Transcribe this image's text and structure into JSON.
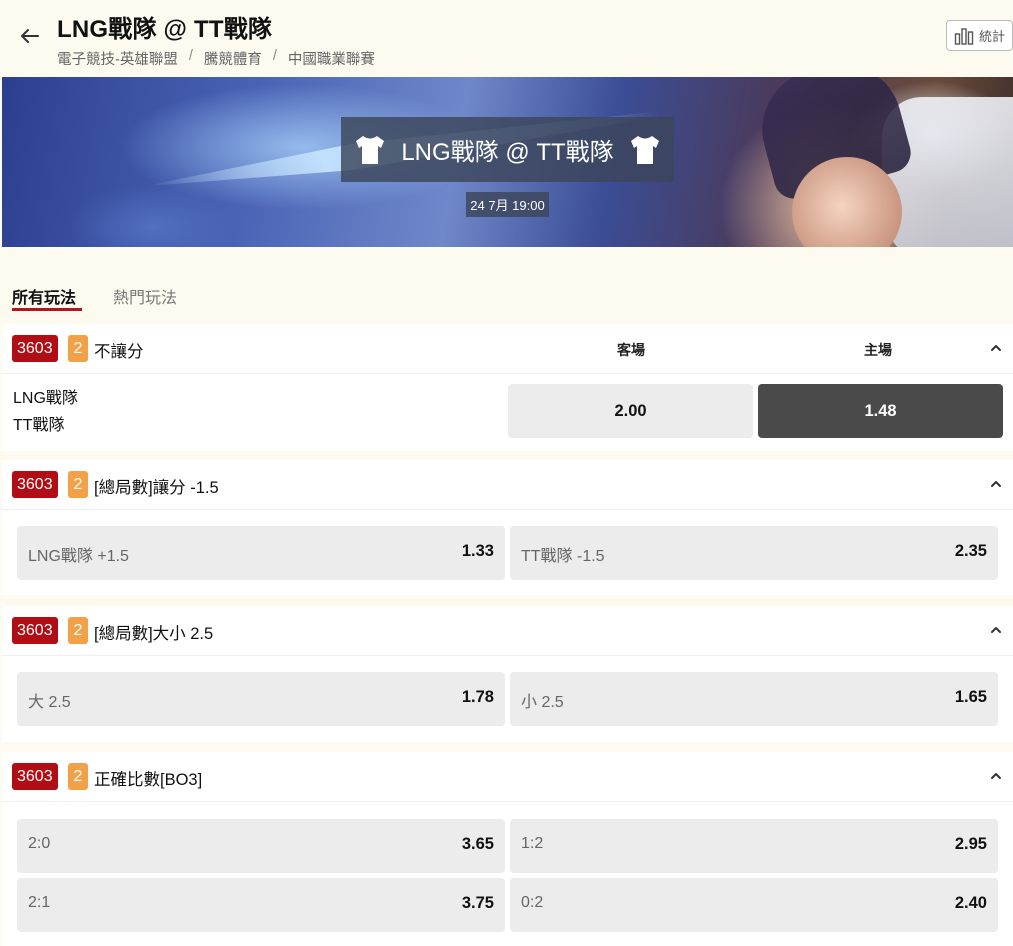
{
  "header": {
    "title": "LNG戰隊 @ TT戰隊",
    "breadcrumbs": [
      "電子競技-英雄聯盟",
      "騰競體育",
      "中國職業聯賽"
    ],
    "stats_label": "統計"
  },
  "banner": {
    "matchup": "LNG戰隊 @ TT戰隊",
    "datetime": "24 7月 19:00"
  },
  "tabs": [
    {
      "label": "所有玩法",
      "active": true
    },
    {
      "label": "熱門玩法",
      "active": false
    }
  ],
  "markets": [
    {
      "code": "3603",
      "count": "2",
      "title": "不讓分",
      "columns": [
        "客場",
        "主場"
      ],
      "teams": [
        "LNG戰隊",
        "TT戰隊"
      ],
      "odds": [
        "2.00",
        "1.48"
      ],
      "selected_index": 1
    },
    {
      "code": "3603",
      "count": "2",
      "title": "[總局數]讓分 -1.5",
      "options": [
        {
          "label": "LNG戰隊 +1.5",
          "odds": "1.33"
        },
        {
          "label": "TT戰隊 -1.5",
          "odds": "2.35"
        }
      ]
    },
    {
      "code": "3603",
      "count": "2",
      "title": "[總局數]大小 2.5",
      "options": [
        {
          "label": "大 2.5",
          "odds": "1.78"
        },
        {
          "label": "小 2.5",
          "odds": "1.65"
        }
      ]
    },
    {
      "code": "3603",
      "count": "2",
      "title": "正確比數[BO3]",
      "options": [
        {
          "label": "2:0",
          "odds": "3.65"
        },
        {
          "label": "1:2",
          "odds": "2.95"
        },
        {
          "label": "2:1",
          "odds": "3.75"
        },
        {
          "label": "0:2",
          "odds": "2.40"
        }
      ]
    }
  ],
  "colors": {
    "background": "#fdfaf0",
    "accent_red": "#b10d14",
    "badge_orange": "#f3a148",
    "selected_odds": "#4a4a4a",
    "odds_button": "#ececec"
  },
  "icons": {
    "back": "arrow-left-icon",
    "stats": "bar-chart-icon",
    "jersey": "jersey-icon",
    "collapse": "chevron-up-icon"
  }
}
